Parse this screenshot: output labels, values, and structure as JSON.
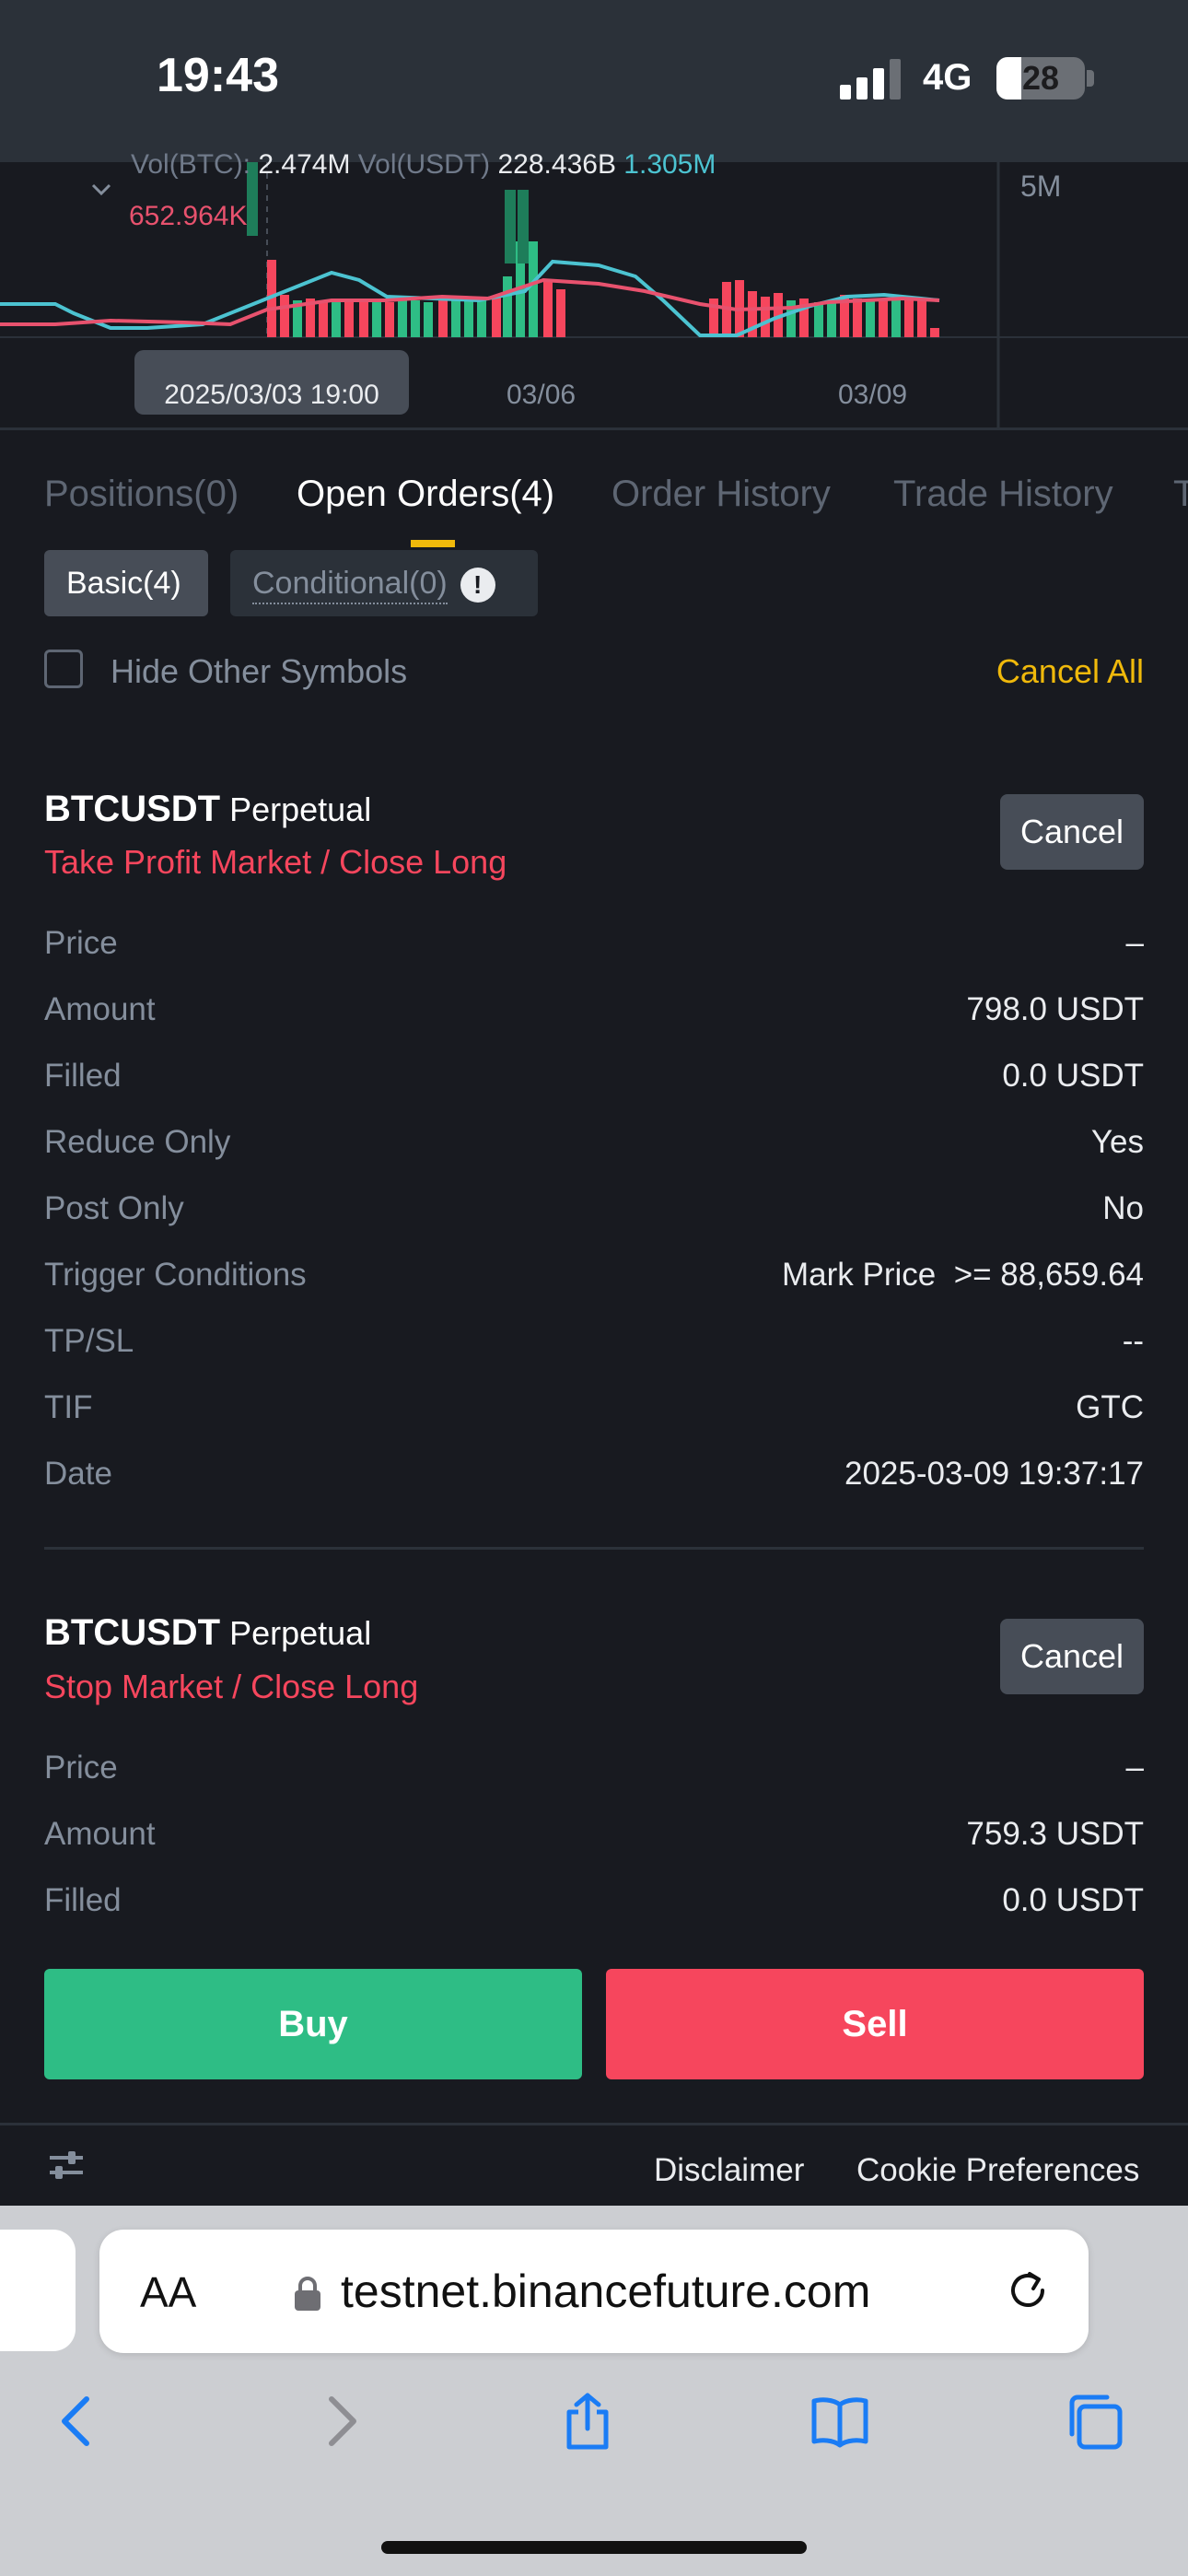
{
  "status_bar": {
    "time": "19:43",
    "network": "4G",
    "battery": "28"
  },
  "chart": {
    "vol_btc_label": "Vol(BTC):",
    "vol_btc_value": "2.474M",
    "vol_usdt_label": "Vol(USDT)",
    "vol_usdt_value": "228.436B",
    "vol_ma_cyan": "1.305M",
    "vol_ma_pink": "652.964K",
    "scale_label": "5M",
    "crosshair_date": "2025/03/03 19:00",
    "x_ticks": [
      "03/06",
      "03/09"
    ]
  },
  "tabs": [
    "Positions(0)",
    "Open Orders(4)",
    "Order History",
    "Trade History",
    "T"
  ],
  "active_tab": "Open Orders(4)",
  "filters": {
    "basic": "Basic(4)",
    "conditional": "Conditional(0)",
    "hide_other_symbols": "Hide Other Symbols",
    "cancel_all": "Cancel All"
  },
  "orders": [
    {
      "symbol": "BTCUSDT",
      "contract": "Perpetual",
      "type": "Take Profit Market / Close Long",
      "cancel_label": "Cancel",
      "rows": [
        {
          "label": "Price",
          "value": "–"
        },
        {
          "label": "Amount",
          "value": "798.0 USDT"
        },
        {
          "label": "Filled",
          "value": "0.0 USDT"
        },
        {
          "label": "Reduce Only",
          "value": "Yes"
        },
        {
          "label": "Post Only",
          "value": "No"
        },
        {
          "label": "Trigger Conditions",
          "value": "Mark Price  >= 88,659.64"
        },
        {
          "label": "TP/SL",
          "value": "--"
        },
        {
          "label": "TIF",
          "value": "GTC"
        },
        {
          "label": "Date",
          "value": "2025-03-09 19:37:17"
        }
      ]
    },
    {
      "symbol": "BTCUSDT",
      "contract": "Perpetual",
      "type": "Stop Market / Close Long",
      "cancel_label": "Cancel",
      "rows": [
        {
          "label": "Price",
          "value": "–"
        },
        {
          "label": "Amount",
          "value": "759.3 USDT"
        },
        {
          "label": "Filled",
          "value": "0.0 USDT"
        }
      ]
    }
  ],
  "actions": {
    "buy": "Buy",
    "sell": "Sell"
  },
  "footer": {
    "disclaimer": "Disclaimer",
    "cookie_preferences": "Cookie Preferences"
  },
  "browser": {
    "text_size_label": "AA",
    "url": "testnet.binancefuture.com"
  },
  "colors": {
    "background": "#181a20",
    "buy_green": "#2ebd85",
    "sell_red": "#f6465d",
    "accent_yellow": "#f0b90b",
    "ma_cyan": "#4cc3d1",
    "ma_pink": "#e8526e"
  }
}
